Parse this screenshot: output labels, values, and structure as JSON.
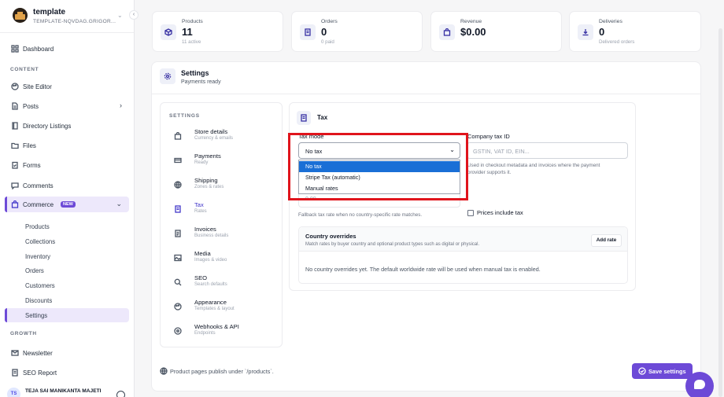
{
  "workspace": {
    "name": "template",
    "subtitle": "TEMPLATE-NQVDAG.GRIGOR..."
  },
  "sidebar": {
    "dashboard": "Dashboard",
    "content_section": "CONTENT",
    "content_items": [
      "Site Editor",
      "Posts",
      "Directory Listings",
      "Files",
      "Forms",
      "Comments"
    ],
    "commerce": {
      "label": "Commerce",
      "badge": "NEW"
    },
    "commerce_items": [
      "Products",
      "Collections",
      "Inventory",
      "Orders",
      "Customers",
      "Discounts",
      "Settings"
    ],
    "growth_section": "GROWTH",
    "growth_items": [
      "Newsletter",
      "SEO Report"
    ],
    "user": {
      "initials": "TS",
      "name": "TEJA SAI MANIKANTA MAJETI"
    }
  },
  "stats": [
    {
      "label": "Products",
      "value": "11",
      "sub": "11 active",
      "icon": "box-icon"
    },
    {
      "label": "Orders",
      "value": "0",
      "sub": "0 paid",
      "icon": "receipt-icon"
    },
    {
      "label": "Revenue",
      "value": "$0.00",
      "sub": "",
      "icon": "bag-icon"
    },
    {
      "label": "Deliveries",
      "value": "0",
      "sub": "Delivered orders",
      "icon": "download-icon"
    }
  ],
  "settings": {
    "title": "Settings",
    "subtitle": "Payments ready",
    "menu_heading": "SETTINGS",
    "menu": [
      {
        "title": "Store details",
        "sub": "Currency & emails"
      },
      {
        "title": "Payments",
        "sub": "Ready"
      },
      {
        "title": "Shipping",
        "sub": "Zones & rates"
      },
      {
        "title": "Tax",
        "sub": "Rates"
      },
      {
        "title": "Invoices",
        "sub": "Business details"
      },
      {
        "title": "Media",
        "sub": "Images & video"
      },
      {
        "title": "SEO",
        "sub": "Search defaults"
      },
      {
        "title": "Appearance",
        "sub": "Templates & layout"
      },
      {
        "title": "Webhooks & API",
        "sub": "Endpoints"
      }
    ]
  },
  "tax": {
    "title": "Tax",
    "mode_label": "Tax mode",
    "mode_value": "No tax",
    "mode_options": [
      "No tax",
      "Stripe Tax (automatic)",
      "Manual rates"
    ],
    "company_tax_label": "Company tax ID",
    "company_tax_placeholder": "GSTIN, VAT ID, EIN...",
    "company_tax_help_1": "Used in checkout metadata and invoices where the payment",
    "company_tax_help_2": "provider supports it.",
    "rate_placeholder": "0.00",
    "rate_help": "Fallback tax rate when no country-specific rate matches.",
    "prices_include_tax": "Prices include tax",
    "overrides": {
      "title": "Country overrides",
      "subtitle": "Match rates by buyer country and optional product types such as digital or physical.",
      "add_button": "Add rate",
      "empty": "No country overrides yet. The default worldwide rate will be used when manual tax is enabled."
    }
  },
  "footer": {
    "note": "Product pages publish under `/products`.",
    "save_button": "Save settings"
  },
  "colors": {
    "accent": "#6d4ad7",
    "highlight": "#e0141c",
    "selected_option": "#1a6fd6"
  }
}
